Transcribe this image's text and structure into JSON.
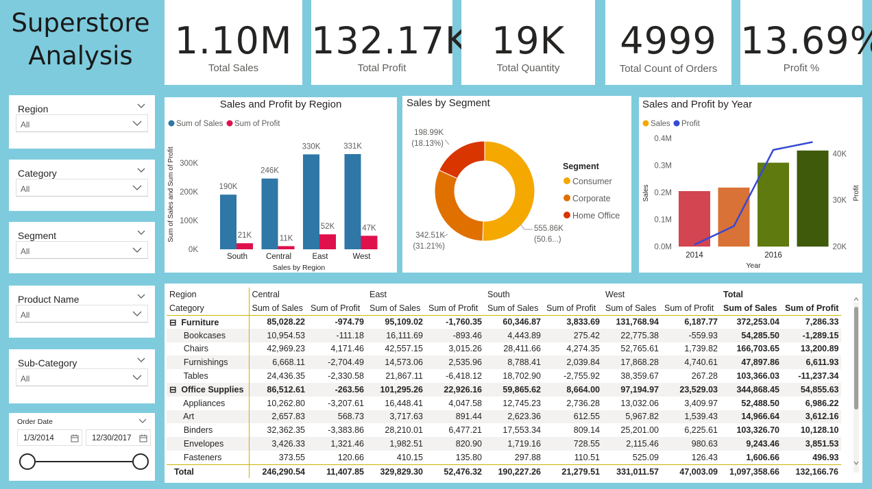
{
  "title": {
    "line1": "Superstore",
    "line2": "Analysis"
  },
  "kpis": [
    {
      "value": "1.10M",
      "label": "Total Sales"
    },
    {
      "value": "132.17K",
      "label": "Total Profit"
    },
    {
      "value": "19K",
      "label": "Total Quantity"
    },
    {
      "value": "4999",
      "label": "Total Count of Orders"
    },
    {
      "value": "13.69%",
      "label": "Profit %"
    }
  ],
  "slicers": [
    {
      "label": "Region",
      "value": "All"
    },
    {
      "label": "Category",
      "value": "All"
    },
    {
      "label": "Segment",
      "value": "All"
    },
    {
      "label": "Product Name",
      "value": "All"
    },
    {
      "label": "Sub-Category",
      "value": "All"
    }
  ],
  "order_date": {
    "label": "Order Date",
    "start": "1/3/2014",
    "end": "12/30/2017"
  },
  "colors": {
    "sales_blue": "#2e77a6",
    "profit_red": "#e0104c",
    "consumer": "#f5a800",
    "corporate": "#e07000",
    "home_office": "#d93500",
    "profit_line": "#3549d6"
  },
  "chart_data": [
    {
      "type": "bar",
      "title": "Sales and Profit by Region",
      "xlabel": "Sales by Region",
      "ylabel": "Sum of Sales and Sum of Profit",
      "categories": [
        "South",
        "Central",
        "East",
        "West"
      ],
      "series": [
        {
          "name": "Sum of Sales",
          "values": [
            190,
            246,
            330,
            331
          ],
          "labels": [
            "190K",
            "246K",
            "330K",
            "331K"
          ]
        },
        {
          "name": "Sum of Profit",
          "values": [
            21,
            11,
            52,
            47
          ],
          "labels": [
            "21K",
            "11K",
            "52K",
            "47K"
          ]
        }
      ],
      "yticks": [
        "0K",
        "100K",
        "200K",
        "300K"
      ],
      "ylim": [
        0,
        350
      ],
      "legend": "top-left"
    },
    {
      "type": "pie",
      "title": "Sales by Segment",
      "legend_title": "Segment",
      "slices": [
        {
          "name": "Consumer",
          "value": 555.86,
          "label": "555.86K",
          "pct": "(50.6...)"
        },
        {
          "name": "Corporate",
          "value": 342.51,
          "label": "342.51K",
          "pct": "(31.21%)"
        },
        {
          "name": "Home Office",
          "value": 198.99,
          "label": "198.99K",
          "pct": "(18.13%)"
        }
      ]
    },
    {
      "type": "bar",
      "title": "Sales and Profit by Year",
      "xlabel": "Year",
      "ylabel": "Sales",
      "y2label": "Profit",
      "x": [
        2014,
        2015,
        2016,
        2017
      ],
      "xticks": [
        "2014",
        "2016"
      ],
      "series": [
        {
          "name": "Sales",
          "values": [
            0.205,
            0.218,
            0.31,
            0.355
          ],
          "colors": [
            "#d24551",
            "#d97236",
            "#5f7a0e",
            "#3e5a0a"
          ]
        },
        {
          "name": "Profit",
          "values": [
            20.4,
            24.4,
            40.8,
            42.5
          ],
          "type": "line"
        }
      ],
      "yticks": [
        "0.0M",
        "0.1M",
        "0.2M",
        "0.3M",
        "0.4M"
      ],
      "y2ticks": [
        "20K",
        "30K",
        "40K"
      ],
      "ylim": [
        0,
        0.4
      ],
      "y2lim": [
        20,
        42.7
      ],
      "legend": "top-left"
    }
  ],
  "matrix": {
    "row_header1": "Region",
    "row_header2": "Category",
    "regions": [
      "Central",
      "East",
      "South",
      "West",
      "Total"
    ],
    "measures": [
      "Sum of Sales",
      "Sum of Profit"
    ],
    "rows": [
      {
        "group": true,
        "name": "Furniture",
        "vals": [
          "85,028.22",
          "-974.79",
          "95,109.02",
          "-1,760.35",
          "60,346.87",
          "3,833.69",
          "131,768.94",
          "6,187.77",
          "372,253.04",
          "7,286.33"
        ]
      },
      {
        "name": "Bookcases",
        "vals": [
          "10,954.53",
          "-111.18",
          "16,111.69",
          "-893.46",
          "4,443.89",
          "275.42",
          "22,775.38",
          "-559.93",
          "54,285.50",
          "-1,289.15"
        ]
      },
      {
        "name": "Chairs",
        "vals": [
          "42,969.23",
          "4,171.46",
          "42,557.15",
          "3,015.26",
          "28,411.66",
          "4,274.35",
          "52,765.61",
          "1,739.82",
          "166,703.65",
          "13,200.89"
        ]
      },
      {
        "name": "Furnishings",
        "vals": [
          "6,668.11",
          "-2,704.49",
          "14,573.06",
          "2,535.96",
          "8,788.41",
          "2,039.84",
          "17,868.28",
          "4,740.61",
          "47,897.86",
          "6,611.93"
        ]
      },
      {
        "name": "Tables",
        "vals": [
          "24,436.35",
          "-2,330.58",
          "21,867.11",
          "-6,418.12",
          "18,702.90",
          "-2,755.92",
          "38,359.67",
          "267.28",
          "103,366.03",
          "-11,237.34"
        ]
      },
      {
        "group": true,
        "name": "Office Supplies",
        "vals": [
          "86,512.61",
          "-263.56",
          "101,295.26",
          "22,926.16",
          "59,865.62",
          "8,664.00",
          "97,194.97",
          "23,529.03",
          "344,868.45",
          "54,855.63"
        ]
      },
      {
        "name": "Appliances",
        "vals": [
          "10,262.80",
          "-3,207.61",
          "16,448.41",
          "4,047.58",
          "12,745.23",
          "2,736.28",
          "13,032.06",
          "3,409.97",
          "52,488.50",
          "6,986.22"
        ]
      },
      {
        "name": "Art",
        "vals": [
          "2,657.83",
          "568.73",
          "3,717.63",
          "891.44",
          "2,623.36",
          "612.55",
          "5,967.82",
          "1,539.43",
          "14,966.64",
          "3,612.16"
        ]
      },
      {
        "name": "Binders",
        "vals": [
          "32,362.35",
          "-3,383.86",
          "28,210.01",
          "6,477.21",
          "17,553.34",
          "809.14",
          "25,201.00",
          "6,225.61",
          "103,326.70",
          "10,128.10"
        ]
      },
      {
        "name": "Envelopes",
        "vals": [
          "3,426.33",
          "1,321.46",
          "1,982.51",
          "820.90",
          "1,719.16",
          "728.55",
          "2,115.46",
          "980.63",
          "9,243.46",
          "3,851.53"
        ]
      },
      {
        "name": "Fasteners",
        "vals": [
          "373.55",
          "120.66",
          "410.15",
          "135.80",
          "297.88",
          "110.51",
          "525.09",
          "126.43",
          "1,606.66",
          "496.93"
        ]
      }
    ],
    "total": {
      "name": "Total",
      "vals": [
        "246,290.54",
        "11,407.85",
        "329,829.30",
        "52,476.32",
        "190,227.26",
        "21,279.51",
        "331,011.57",
        "47,003.09",
        "1,097,358.66",
        "132,166.76"
      ]
    }
  }
}
